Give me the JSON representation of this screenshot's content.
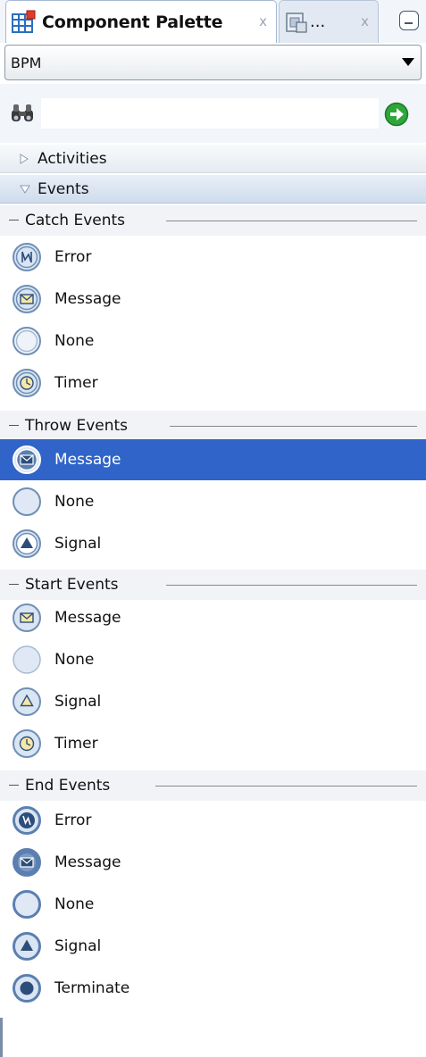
{
  "tabs": [
    {
      "title": "Component Palette",
      "close": "x",
      "icon": "palette-grid-icon"
    },
    {
      "title": "...",
      "close": "x",
      "icon": "resource-catalog-icon"
    }
  ],
  "dropdown": {
    "value": "BPM"
  },
  "search": {
    "value": "",
    "placeholder": ""
  },
  "sections": [
    {
      "label": "Activities",
      "expanded": false
    },
    {
      "label": "Events",
      "expanded": true
    }
  ],
  "groups": [
    {
      "label": "Catch Events",
      "items": [
        {
          "label": "Error",
          "icon": "error-catch-event-icon"
        },
        {
          "label": "Message",
          "icon": "message-catch-event-icon"
        },
        {
          "label": "None",
          "icon": "none-catch-event-icon"
        },
        {
          "label": "Timer",
          "icon": "timer-catch-event-icon"
        }
      ]
    },
    {
      "label": "Throw Events",
      "items": [
        {
          "label": "Message",
          "icon": "message-throw-event-icon",
          "selected": true
        },
        {
          "label": "None",
          "icon": "none-throw-event-icon"
        },
        {
          "label": "Signal",
          "icon": "signal-throw-event-icon"
        }
      ]
    },
    {
      "label": "Start Events",
      "items": [
        {
          "label": "Message",
          "icon": "message-start-event-icon"
        },
        {
          "label": "None",
          "icon": "none-start-event-icon"
        },
        {
          "label": "Signal",
          "icon": "signal-start-event-icon"
        },
        {
          "label": "Timer",
          "icon": "timer-start-event-icon"
        }
      ]
    },
    {
      "label": "End Events",
      "items": [
        {
          "label": "Error",
          "icon": "error-end-event-icon"
        },
        {
          "label": "Message",
          "icon": "message-end-event-icon"
        },
        {
          "label": "None",
          "icon": "none-end-event-icon"
        },
        {
          "label": "Signal",
          "icon": "signal-end-event-icon"
        },
        {
          "label": "Terminate",
          "icon": "terminate-end-event-icon"
        }
      ]
    }
  ],
  "colors": {
    "selection": "#3064c8",
    "event_fill": "#d9e5f3",
    "event_ring": "#6f8fb6",
    "accent_go": "#2ea63a"
  }
}
